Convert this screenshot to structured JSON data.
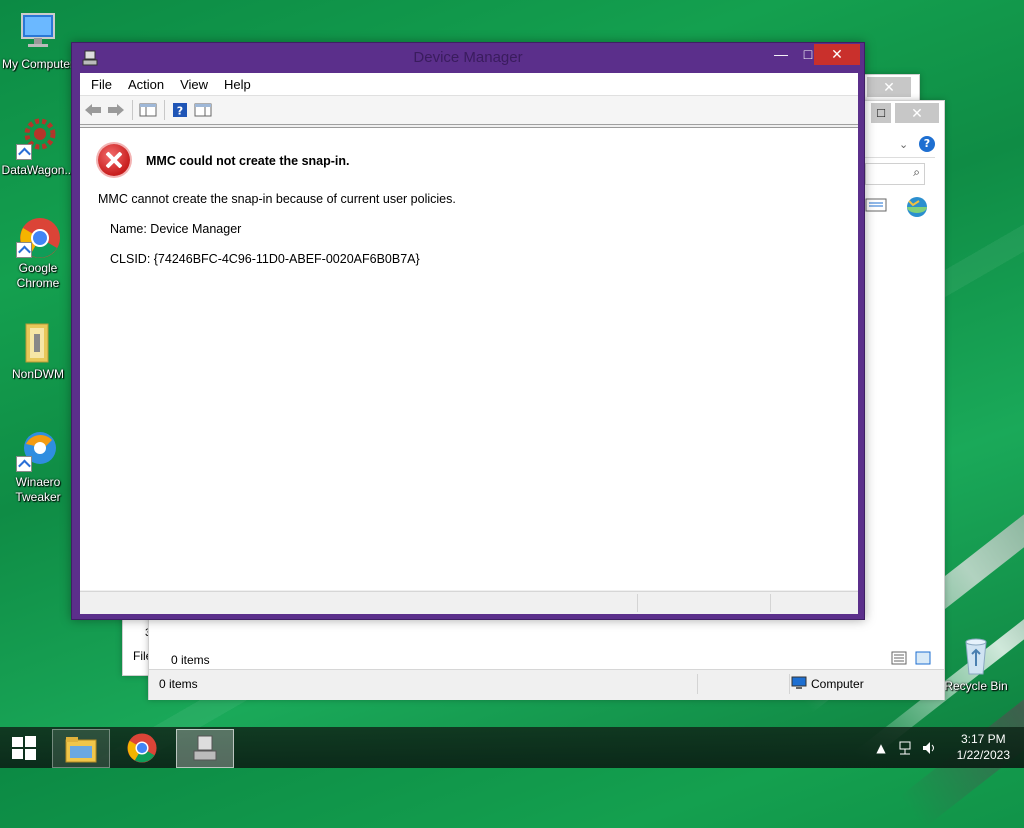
{
  "desktop": {
    "icons": [
      {
        "label": "My Computer"
      },
      {
        "label": "DataWagon..."
      },
      {
        "label": "Google Chrome"
      },
      {
        "label": "NonDWM"
      },
      {
        "label": "Winaero Tweaker"
      },
      {
        "label": "Recycle Bin"
      }
    ]
  },
  "back_window_1": {
    "status_items": "0 items",
    "status_location": "Computer",
    "file_label": "File",
    "row_marker": "3"
  },
  "back_window_2": {
    "status_items": "0 items"
  },
  "device_manager": {
    "title": "Device Manager",
    "menu": [
      "File",
      "Action",
      "View",
      "Help"
    ],
    "error_title": "MMC could not create the snap-in.",
    "error_message": "MMC cannot create the snap-in because of current user policies.",
    "name_line": "Name: Device Manager",
    "clsid_line": "CLSID: {74246BFC-4C96-11D0-ABEF-0020AF6B0B7A}"
  },
  "taskbar": {
    "time": "3:17 PM",
    "date": "1/22/2023"
  },
  "colors": {
    "window_frame": "#5b2f8b",
    "close_button": "#c9302c",
    "desktop": "#14a04f"
  }
}
